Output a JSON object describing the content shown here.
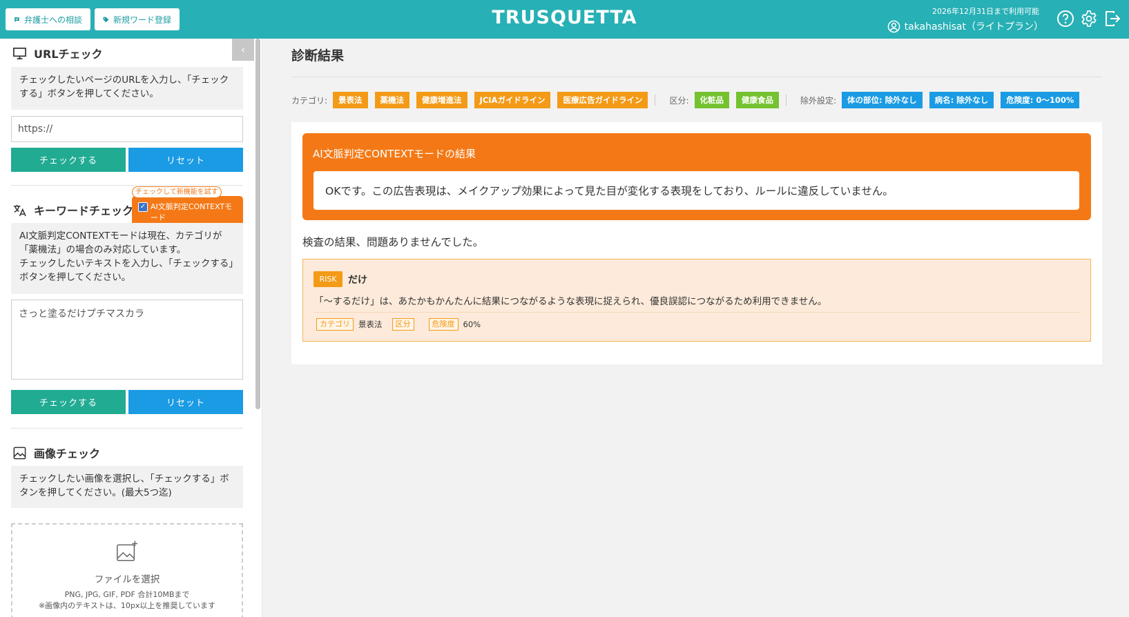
{
  "header": {
    "lawyer_button": "弁護士への相談",
    "register_button": "新規ワード登録",
    "logo": "TRUSQUETTA",
    "expiry": "2026年12月31日まで利用可能",
    "user": "takahashisat（ライトプラン）",
    "icons": [
      "help-circle-icon",
      "gear-icon",
      "logout-icon"
    ],
    "color": "#27b0b5"
  },
  "sidebar": {
    "url_check": {
      "title": "URLチェック",
      "description": "チェックしたいページのURLを入力し、「チェックする」ボタンを押してください。",
      "input_placeholder": "https://",
      "check_button": "チェックする",
      "reset_button": "リセット"
    },
    "keyword_check": {
      "title": "キーワードチェック",
      "tooltip": "チェックして新機能を試す",
      "context_checkbox_label": "AI文脈判定CONTEXTモード",
      "context_checked": true,
      "description_line1": "AI文脈判定CONTEXTモードは現在、カテゴリが「薬機法」の場合のみ対応しています。",
      "description_line2": "チェックしたいテキストを入力し、「チェックする」ボタンを押してください。",
      "input_value": "さっと塗るだけプチマスカラ",
      "check_button": "チェックする",
      "reset_button": "リセット"
    },
    "image_check": {
      "title": "画像チェック",
      "description": "チェックしたい画像を選択し、「チェックする」ボタンを押してください。(最大5つ迄)",
      "dropzone_label": "ファイルを選択",
      "dropzone_note1": "PNG, JPG, GIF, PDF 合計10MBまで",
      "dropzone_note2": "※画像内のテキストは、10px以上を推奨しています"
    }
  },
  "main": {
    "title": "診断結果",
    "filters": {
      "category_label": "カテゴリ:",
      "categories": [
        "景表法",
        "薬機法",
        "健康増進法",
        "JCIAガイドライン",
        "医療広告ガイドライン"
      ],
      "division_label": "区分:",
      "divisions": [
        "化粧品",
        "健康食品"
      ],
      "exclusion_label": "除外設定:",
      "exclusions": [
        "体の部位: 除外なし",
        "病名: 除外なし",
        "危険度: 0〜100%"
      ]
    },
    "ai_result": {
      "title": "AI文脈判定CONTEXTモードの結果",
      "text": "OKです。この広告表現は、メイクアップ効果によって見た目が変化する表現をしており、ルールに違反していません。"
    },
    "result_text": "検査の結果、問題ありませんでした。",
    "risk": {
      "badge": "RISK",
      "word": "だけ",
      "description": "「〜するだけ」は、あたかもかんたんに結果につながるような表現に捉えられ、優良誤認につながるため利用できません。",
      "category_label": "カテゴリ",
      "category_value": "景表法",
      "division_label": "区分",
      "division_value": "",
      "risk_label": "危険度",
      "risk_value": "60%"
    }
  }
}
